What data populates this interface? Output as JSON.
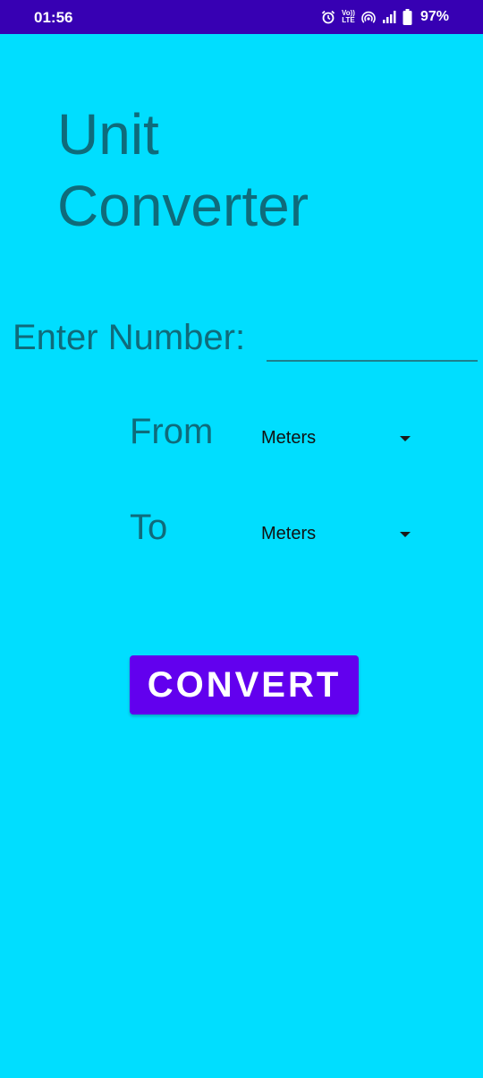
{
  "status_bar": {
    "time": "01:56",
    "volte_top": "Vo))",
    "volte_bottom": "LTE",
    "battery_percent": "97%",
    "icons": [
      "alarm-icon",
      "volte-icon",
      "hotspot-icon",
      "signal-icon",
      "battery-icon"
    ]
  },
  "title": {
    "line1": "Unit",
    "line2": "Converter"
  },
  "input": {
    "label": "Enter Number:",
    "value": "",
    "placeholder": ""
  },
  "from": {
    "label": "From",
    "selected": "Meters"
  },
  "to": {
    "label": "To",
    "selected": "Meters"
  },
  "convert_button": {
    "label": "CONVERT"
  },
  "colors": {
    "background": "#00DEFF",
    "status_bar": "#3700B3",
    "text": "#0F6B7B",
    "button": "#6200EE"
  }
}
